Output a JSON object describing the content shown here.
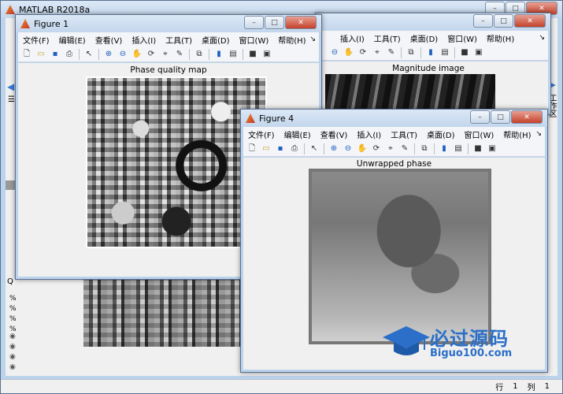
{
  "matlab": {
    "title": "MATLAB R2018a",
    "side_labels": [
      "工作区"
    ],
    "left_gutter": [
      "%",
      "%",
      "%",
      "%"
    ],
    "status": {
      "row_label": "行",
      "row": "1",
      "col_label": "列",
      "col": "1"
    }
  },
  "fig1": {
    "title": "Figure 1",
    "axes_title": "Phase quality map"
  },
  "fig2": {
    "axes_title": "Magnitude image"
  },
  "fig4": {
    "title": "Figure 4",
    "axes_title": "Unwrapped phase"
  },
  "menu": {
    "file": "文件(F)",
    "edit": "编辑(E)",
    "view": "查看(V)",
    "insert": "插入(I)",
    "tools": "工具(T)",
    "desktop": "桌面(D)",
    "window": "窗口(W)",
    "help": "帮助(H)"
  },
  "watermark": {
    "main": "必过源码",
    "sub": "Biguo100.com"
  },
  "colors": {
    "desktop": "#6b8fb8",
    "titlebar": "#c3d6ec",
    "close": "#c4412b",
    "watermark": "#2b6fc8"
  }
}
